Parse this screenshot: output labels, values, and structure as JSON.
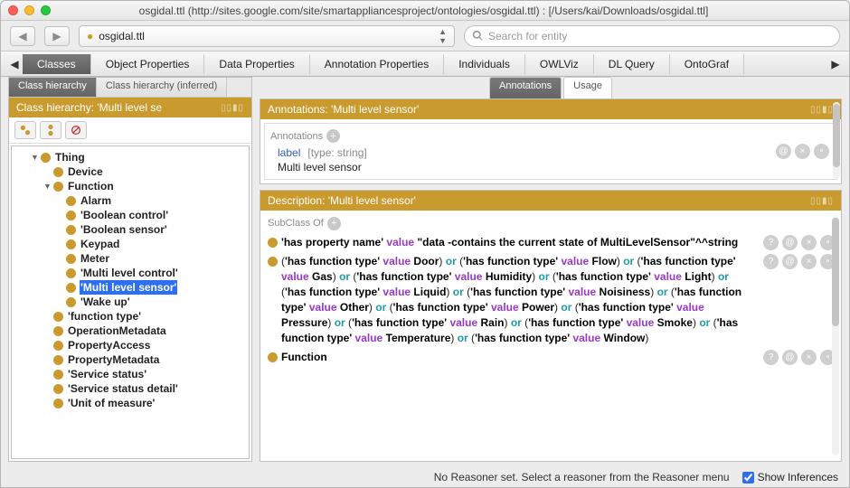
{
  "window": {
    "title": "osgidal.ttl (http://sites.google.com/site/smartappliancesproject/ontologies/osgidal.ttl)  : [/Users/kai/Downloads/osgidal.ttl]"
  },
  "toolbar": {
    "dropdown_label": "osgidal.ttl",
    "search_placeholder": "Search for entity"
  },
  "main_tabs": [
    "Classes",
    "Object Properties",
    "Data Properties",
    "Annotation Properties",
    "Individuals",
    "OWLViz",
    "DL Query",
    "OntoGraf"
  ],
  "main_tab_selected": 0,
  "left": {
    "subtabs": [
      "Class hierarchy",
      "Class hierarchy (inferred)"
    ],
    "subtab_selected": 0,
    "header": "Class hierarchy: 'Multi level se",
    "panel_ctrl": "▯▯▮▯",
    "tree": [
      {
        "d": 0,
        "exp": "▼",
        "label": "Thing"
      },
      {
        "d": 1,
        "exp": "",
        "label": "Device"
      },
      {
        "d": 1,
        "exp": "▼",
        "label": "Function"
      },
      {
        "d": 2,
        "exp": "",
        "label": "Alarm"
      },
      {
        "d": 2,
        "exp": "",
        "label": "'Boolean control'"
      },
      {
        "d": 2,
        "exp": "",
        "label": "'Boolean sensor'"
      },
      {
        "d": 2,
        "exp": "",
        "label": "Keypad"
      },
      {
        "d": 2,
        "exp": "",
        "label": "Meter"
      },
      {
        "d": 2,
        "exp": "",
        "label": "'Multi level control'"
      },
      {
        "d": 2,
        "exp": "",
        "label": "'Multi level sensor'",
        "sel": true
      },
      {
        "d": 2,
        "exp": "",
        "label": "'Wake up'"
      },
      {
        "d": 1,
        "exp": "",
        "label": "'function type'"
      },
      {
        "d": 1,
        "exp": "",
        "label": "OperationMetadata"
      },
      {
        "d": 1,
        "exp": "",
        "label": "PropertyAccess"
      },
      {
        "d": 1,
        "exp": "",
        "label": "PropertyMetadata"
      },
      {
        "d": 1,
        "exp": "",
        "label": "'Service status'"
      },
      {
        "d": 1,
        "exp": "",
        "label": "'Service status detail'"
      },
      {
        "d": 1,
        "exp": "",
        "label": "'Unit of measure'"
      }
    ]
  },
  "right": {
    "top_tabs": [
      "Annotations",
      "Usage"
    ],
    "top_tab_selected": 0,
    "annotations": {
      "header": "Annotations: 'Multi level sensor'",
      "panel_ctrl": "▯▯▮▯",
      "section_label": "Annotations",
      "rows": [
        {
          "prop": "label",
          "type": "[type: string]",
          "value": "Multi level sensor"
        }
      ]
    },
    "description": {
      "header": "Description: 'Multi level sensor'",
      "panel_ctrl": "▯▯▮▯",
      "section_label": "SubClass Of",
      "axioms": [
        {
          "html": "<span class='kw-prop'>'has property name'</span> <span class='kw-val'>value</span> <span class='kw-prop'>\"data -contains the current state of MultiLevelSensor\"^^string</span>"
        },
        {
          "html": "(<span class='kw-prop'>'has function type'</span> <span class='kw-val'>value</span> <span class='kw-cls'>Door</span>) <span class='kw-or'>or</span> (<span class='kw-prop'>'has function type'</span> <span class='kw-val'>value</span> <span class='kw-cls'>Flow</span>) <span class='kw-or'>or</span> (<span class='kw-prop'>'has function type'</span> <span class='kw-val'>value</span> <span class='kw-cls'>Gas</span>) <span class='kw-or'>or</span> (<span class='kw-prop'>'has function type'</span> <span class='kw-val'>value</span> <span class='kw-cls'>Humidity</span>) <span class='kw-or'>or</span> (<span class='kw-prop'>'has function type'</span> <span class='kw-val'>value</span> <span class='kw-cls'>Light</span>) <span class='kw-or'>or</span> (<span class='kw-prop'>'has function type'</span> <span class='kw-val'>value</span> <span class='kw-cls'>Liquid</span>) <span class='kw-or'>or</span> (<span class='kw-prop'>'has function type'</span> <span class='kw-val'>value</span> <span class='kw-cls'>Noisiness</span>) <span class='kw-or'>or</span> (<span class='kw-prop'>'has function type'</span> <span class='kw-val'>value</span> <span class='kw-cls'>Other</span>) <span class='kw-or'>or</span> (<span class='kw-prop'>'has function type'</span> <span class='kw-val'>value</span> <span class='kw-cls'>Power</span>) <span class='kw-or'>or</span> (<span class='kw-prop'>'has function type'</span> <span class='kw-val'>value</span> <span class='kw-cls'>Pressure</span>) <span class='kw-or'>or</span> (<span class='kw-prop'>'has function type'</span> <span class='kw-val'>value</span> <span class='kw-cls'>Rain</span>) <span class='kw-or'>or</span> (<span class='kw-prop'>'has function type'</span> <span class='kw-val'>value</span> <span class='kw-cls'>Smoke</span>) <span class='kw-or'>or</span> (<span class='kw-prop'>'has function type'</span> <span class='kw-val'>value</span> <span class='kw-cls'>Temperature</span>) <span class='kw-or'>or</span> (<span class='kw-prop'>'has function type'</span> <span class='kw-val'>value</span> <span class='kw-cls'>Window</span>)"
        },
        {
          "html": "<span class='kw-cls'>Function</span>"
        }
      ]
    }
  },
  "footer": {
    "message": "No Reasoner set. Select a reasoner from the Reasoner menu",
    "checkbox_label": "Show Inferences",
    "checkbox_checked": true
  }
}
